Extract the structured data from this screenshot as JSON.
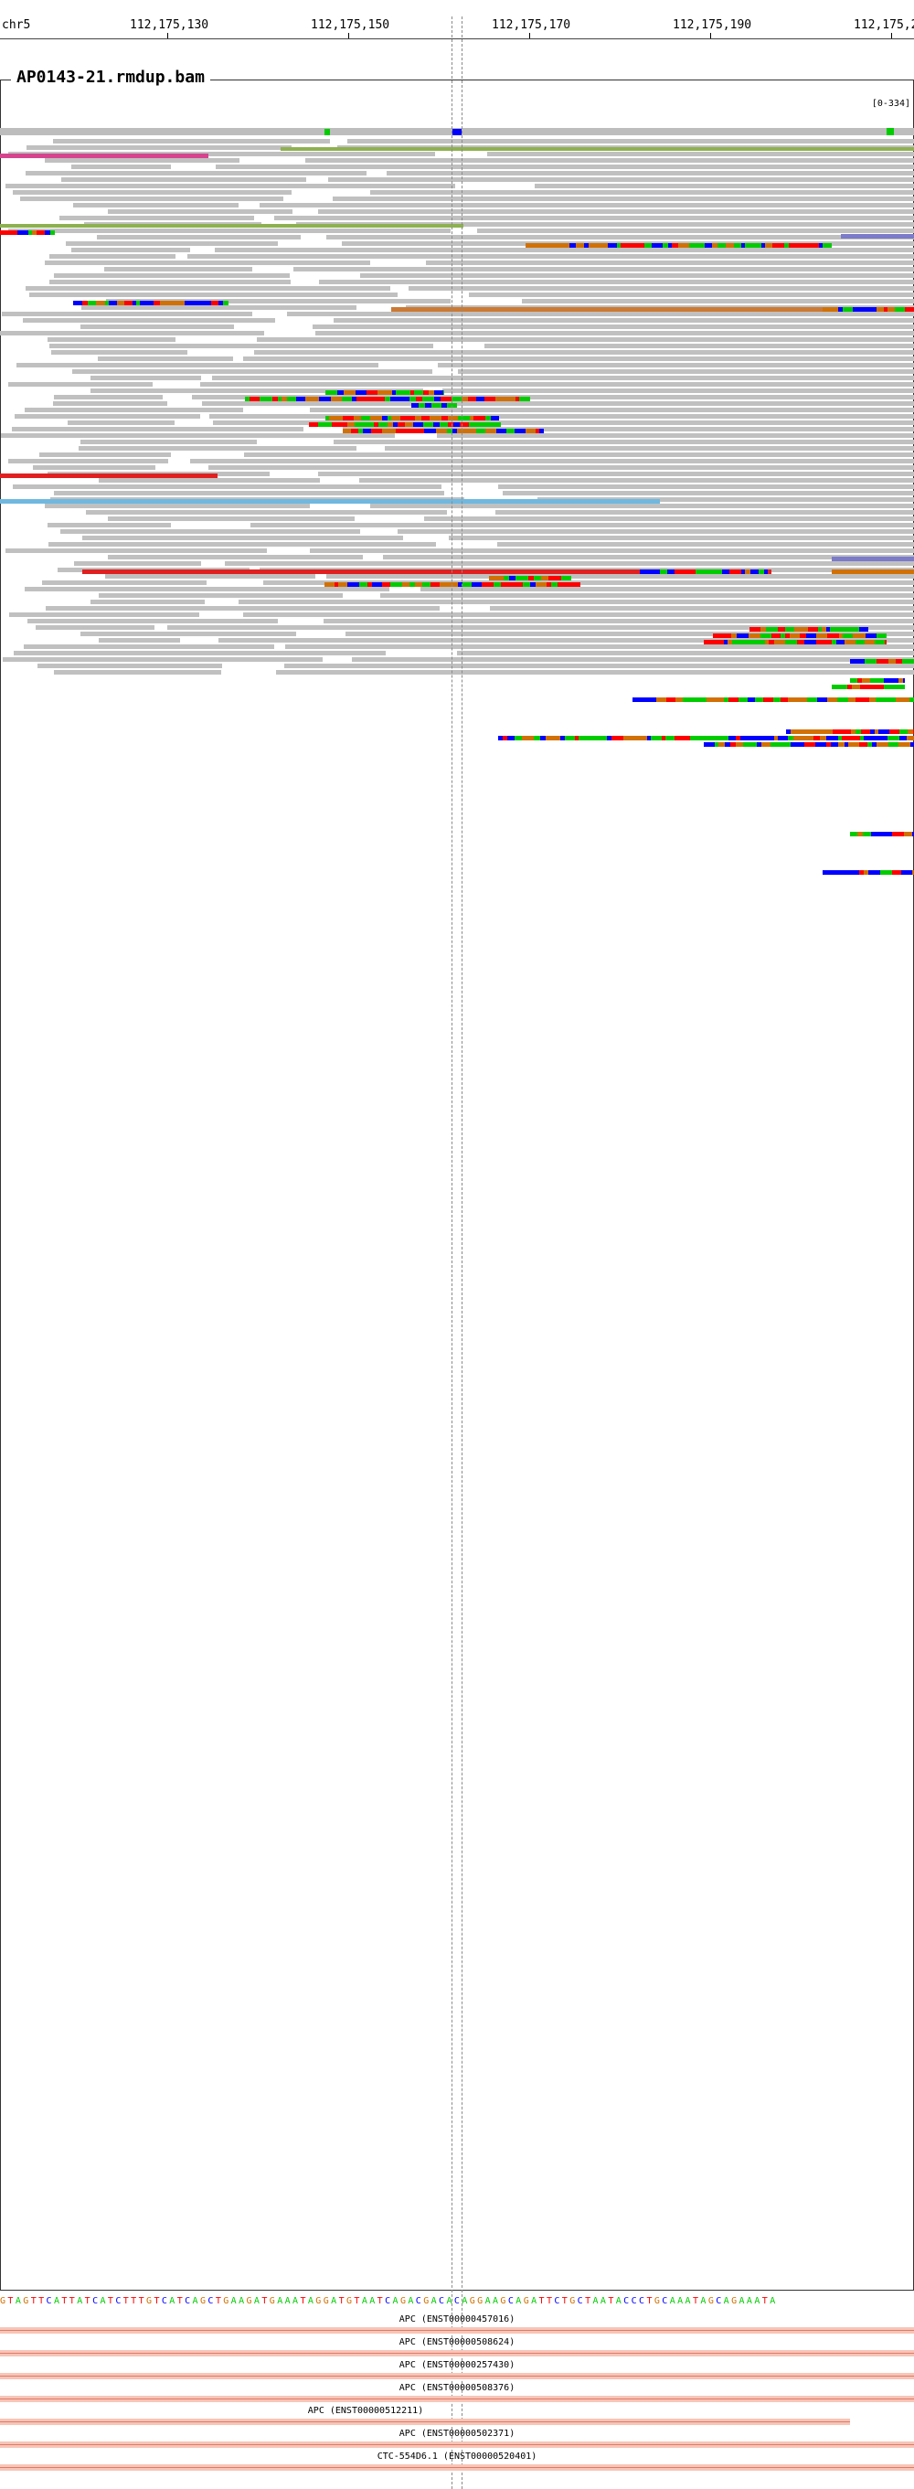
{
  "ruler": {
    "chromosome": "chr5",
    "ticks": [
      "112,175,130",
      "112,175,150",
      "112,175,170",
      "112,175,190",
      "112,175,2"
    ]
  },
  "track": {
    "name": "AP0143-21.rmdup.bam",
    "range": "[0-334]"
  },
  "sequence": "GTAGTTCATTATCATCTTTGTCATCAGCTGAAGATGAAATAGGATGTAATCAGACGACACAGGAAGCAGATTCTGCTAATACCCTGCAAATAGCAGAAATA",
  "genes": [
    "APC (ENST00000457016)",
    "APC (ENST00000508624)",
    "APC (ENST00000257430)",
    "APC (ENST00000508376)",
    "APC (ENST00000512211)",
    "APC (ENST00000502371)",
    "CTC-554D6.1 (ENST00000520401)"
  ],
  "colors": {
    "read": "#c0c0c0",
    "A": "#00cc00",
    "C": "#0000ff",
    "G": "#d17105",
    "T": "#ff0000",
    "insert_large": "#e02020",
    "insert_small": "#6fb8e0",
    "inversion": "#8a8a8a",
    "pair_orient": "#7b7bc9",
    "other_chr_green": "#8db14f",
    "other_chr_pink": "#d6448e",
    "gene": "#e07a68"
  }
}
